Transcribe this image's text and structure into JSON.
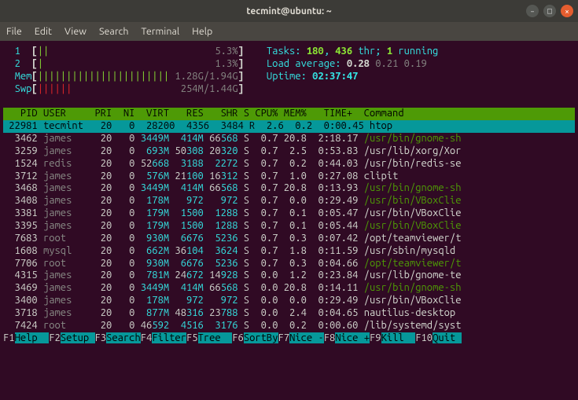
{
  "window": {
    "title": "tecmint@ubuntu: ~"
  },
  "menubar": [
    "File",
    "Edit",
    "View",
    "Search",
    "Terminal",
    "Help"
  ],
  "meters": {
    "cpu": [
      {
        "id": "1",
        "bar": "||",
        "pct": "5.3%"
      },
      {
        "id": "2",
        "bar": "|",
        "pct": "1.3%"
      }
    ],
    "mem": {
      "label": "Mem",
      "bar": "|||||||||||||||||||||||",
      "val": "1.28G/1.94G"
    },
    "swp": {
      "label": "Swp",
      "bar": "||||||",
      "val": "254M/1.44G"
    },
    "tasks": {
      "label": "Tasks: ",
      "procs": "180",
      "sep": ", ",
      "thr": "436",
      "thr_lbl": " thr; ",
      "running": "1",
      "running_lbl": " running"
    },
    "load": {
      "label": "Load average: ",
      "a": "0.28",
      "b": "0.21",
      "c": "0.19"
    },
    "uptime": {
      "label": "Uptime: ",
      "val": "02:37:47"
    }
  },
  "header": [
    "  PID",
    "USER    ",
    "PRI",
    " NI",
    " VIRT",
    "  RES",
    "  SHR",
    "S",
    "CPU%",
    "MEM%",
    "  TIME+ ",
    "Command"
  ],
  "rows": [
    {
      "pid": "22981",
      "user": "tecmint",
      "pri": "20",
      "ni": "0",
      "virt": "28200",
      "res": "4356",
      "shr": "3484",
      "s": "R",
      "cpu": "2.6",
      "mem": "0.2",
      "time": "0:00.45",
      "cmd": "htop",
      "hl": true
    },
    {
      "pid": " 3462",
      "user": "james",
      "pri": "20",
      "ni": "0",
      "virt": "3449M",
      "res": "414M",
      "shr_pfx": "66",
      "shr": "568",
      "s": "S",
      "cpu": "0.7",
      "mem": "20.8",
      "time": "2:18.17",
      "cmd": "/usr/bin/gnome-sh",
      "cmd_green": true
    },
    {
      "pid": " 3259",
      "user": "james",
      "pri": "20",
      "ni": "0",
      "virt": "693M",
      "res_pfx": "50",
      "res": "308",
      "shr_pfx": "20",
      "shr": "320",
      "s": "S",
      "cpu": "0.7",
      "mem": "2.5",
      "time": "0:53.83",
      "cmd": "/usr/lib/xorg/Xor"
    },
    {
      "pid": " 1524",
      "user": "redis",
      "pri": "20",
      "ni": "0",
      "virt_pfx": "52",
      "virt": "668",
      "res": "3188",
      "shr": "2272",
      "s": "S",
      "cpu": "0.7",
      "mem": "0.2",
      "time": "0:44.03",
      "cmd": "/usr/bin/redis-se"
    },
    {
      "pid": " 3712",
      "user": "james",
      "pri": "20",
      "ni": "0",
      "virt": "576M",
      "res_pfx": "21",
      "res": "100",
      "shr_pfx": "16",
      "shr": "312",
      "s": "S",
      "cpu": "0.7",
      "mem": "1.0",
      "time": "0:27.08",
      "cmd": "clipit"
    },
    {
      "pid": " 3468",
      "user": "james",
      "pri": "20",
      "ni": "0",
      "virt": "3449M",
      "res": "414M",
      "shr_pfx": "66",
      "shr": "568",
      "s": "S",
      "cpu": "0.7",
      "mem": "20.8",
      "time": "0:13.93",
      "cmd": "/usr/bin/gnome-sh",
      "cmd_green": true
    },
    {
      "pid": " 3408",
      "user": "james",
      "pri": "20",
      "ni": "0",
      "virt": "178M",
      "res": "972",
      "shr": "972",
      "s": "S",
      "cpu": "0.7",
      "mem": "0.0",
      "time": "0:29.49",
      "cmd": "/usr/bin/VBoxClie",
      "cmd_green": true
    },
    {
      "pid": " 3381",
      "user": "james",
      "pri": "20",
      "ni": "0",
      "virt": "179M",
      "res": "1500",
      "shr": "1288",
      "s": "S",
      "cpu": "0.7",
      "mem": "0.1",
      "time": "0:05.47",
      "cmd": "/usr/bin/VBoxClie"
    },
    {
      "pid": " 3395",
      "user": "james",
      "pri": "20",
      "ni": "0",
      "virt": "179M",
      "res": "1500",
      "shr": "1288",
      "s": "S",
      "cpu": "0.7",
      "mem": "0.1",
      "time": "0:05.44",
      "cmd": "/usr/bin/VBoxClie",
      "cmd_green": true
    },
    {
      "pid": " 7683",
      "user": "root",
      "pri": "20",
      "ni": "0",
      "virt": "930M",
      "res": "6676",
      "shr": "5236",
      "s": "S",
      "cpu": "0.7",
      "mem": "0.3",
      "time": "0:07.42",
      "cmd": "/opt/teamviewer/t"
    },
    {
      "pid": " 1608",
      "user": "mysql",
      "pri": "20",
      "ni": "0",
      "virt": "662M",
      "res_pfx": "36",
      "res": "104",
      "shr": "3624",
      "s": "S",
      "cpu": "0.7",
      "mem": "1.8",
      "time": "0:11.59",
      "cmd": "/usr/sbin/mysqld"
    },
    {
      "pid": " 7706",
      "user": "root",
      "pri": "20",
      "ni": "0",
      "virt": "930M",
      "res": "6676",
      "shr": "5236",
      "s": "S",
      "cpu": "0.7",
      "mem": "0.3",
      "time": "0:04.66",
      "cmd": "/opt/teamviewer/t",
      "cmd_green": true
    },
    {
      "pid": " 4315",
      "user": "james",
      "pri": "20",
      "ni": "0",
      "virt": "781M",
      "res_pfx": "24",
      "res": "672",
      "shr_pfx": "14",
      "shr": "928",
      "s": "S",
      "cpu": "0.0",
      "mem": "1.2",
      "time": "0:23.84",
      "cmd": "/usr/lib/gnome-te"
    },
    {
      "pid": " 3469",
      "user": "james",
      "pri": "20",
      "ni": "0",
      "virt": "3449M",
      "res": "414M",
      "shr_pfx": "66",
      "shr": "568",
      "s": "S",
      "cpu": "0.0",
      "mem": "20.8",
      "time": "0:14.11",
      "cmd": "/usr/bin/gnome-sh",
      "cmd_green": true
    },
    {
      "pid": " 3400",
      "user": "james",
      "pri": "20",
      "ni": "0",
      "virt": "178M",
      "res": "972",
      "shr": "972",
      "s": "S",
      "cpu": "0.0",
      "mem": "0.0",
      "time": "0:29.49",
      "cmd": "/usr/bin/VBoxClie"
    },
    {
      "pid": " 3718",
      "user": "james",
      "pri": "20",
      "ni": "0",
      "virt": "877M",
      "res_pfx": "48",
      "res": "316",
      "shr_pfx": "23",
      "shr": "788",
      "s": "S",
      "cpu": "0.0",
      "mem": "2.4",
      "time": "0:04.65",
      "cmd": "nautilus-desktop"
    },
    {
      "pid": " 7424",
      "user": "root",
      "pri": "20",
      "ni": "0",
      "virt_pfx": "46",
      "virt": "592",
      "res": "4516",
      "shr": "3176",
      "s": "S",
      "cpu": "0.0",
      "mem": "0.2",
      "time": "0:00.60",
      "cmd": "/lib/systemd/syst"
    }
  ],
  "footer": [
    {
      "k": "F1",
      "l": "Help  "
    },
    {
      "k": "F2",
      "l": "Setup "
    },
    {
      "k": "F3",
      "l": "Search"
    },
    {
      "k": "F4",
      "l": "Filter"
    },
    {
      "k": "F5",
      "l": "Tree  "
    },
    {
      "k": "F6",
      "l": "SortBy"
    },
    {
      "k": "F7",
      "l": "Nice -"
    },
    {
      "k": "F8",
      "l": "Nice +"
    },
    {
      "k": "F9",
      "l": "Kill  "
    },
    {
      "k": "F10",
      "l": "Quit "
    }
  ]
}
